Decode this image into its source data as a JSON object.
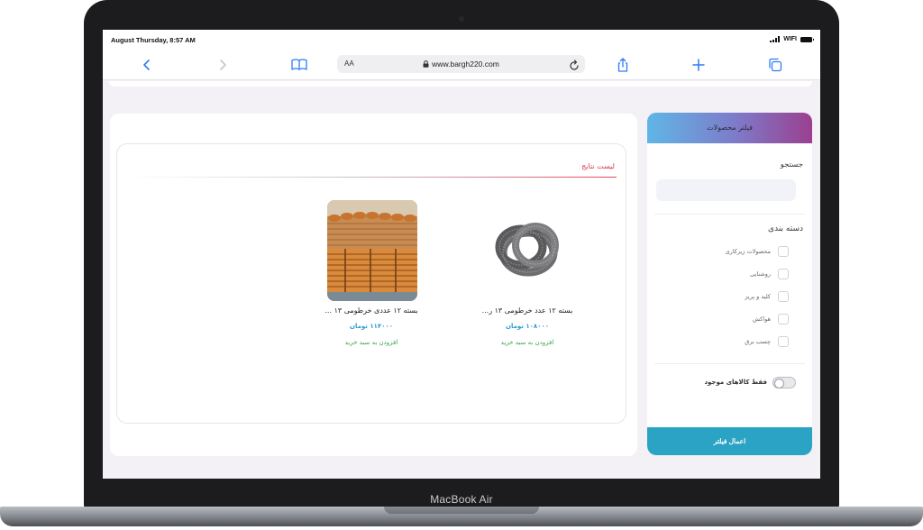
{
  "device": {
    "label": "MacBook Air"
  },
  "status_bar": {
    "time": "August Thursday, 8:57 AM",
    "wifi": "WIFI"
  },
  "browser": {
    "text_size_label": "AA",
    "url": "www.bargh220.com",
    "icons": [
      "back-icon",
      "forward-icon",
      "bookmarks-icon",
      "lock-icon",
      "reload-icon",
      "share-icon",
      "new-tab-icon",
      "tabs-icon"
    ]
  },
  "results": {
    "title": "لیست نتایج",
    "products": [
      {
        "name": "بسته ۱۲ عدد خرطومی ۱۳ ر...",
        "price": "۱۰۸۰۰۰ تومان",
        "add_to_cart": "افزودن به سبد خرید",
        "image": "coiled-hose"
      },
      {
        "name": "بسته ۱۲ عددی خرطومی ۱۳ ...",
        "price": "۱۱۴۰۰۰ تومان",
        "add_to_cart": "افزودن به سبد خرید",
        "image": "hose-rolls-stack"
      }
    ]
  },
  "filter": {
    "title": "فیلتر محصولات",
    "search_label": "جستجو",
    "search_value": "",
    "category_label": "دسته بندی",
    "categories": [
      {
        "label": "محصولات زیرکاری",
        "checked": false
      },
      {
        "label": "روشنایی",
        "checked": false
      },
      {
        "label": "کلید و پریز",
        "checked": false
      },
      {
        "label": "هواکش",
        "checked": false
      },
      {
        "label": "چسب برق",
        "checked": false
      }
    ],
    "in_stock_label": "فقط کالاهای موجود",
    "in_stock_on": false,
    "apply_label": "اعمال فیلتر"
  },
  "colors": {
    "accent_title": "#e0344f",
    "price": "#2d9bd6",
    "add_to_cart": "#3aa34a",
    "apply_button": "#2aa3c4"
  }
}
